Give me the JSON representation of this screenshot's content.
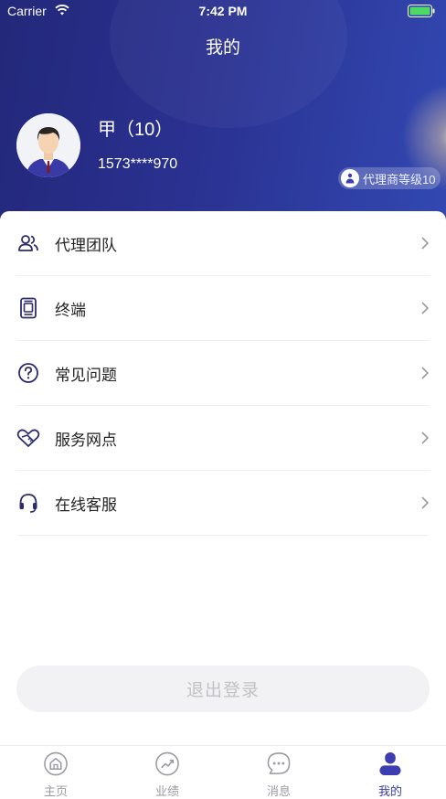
{
  "status_bar": {
    "carrier": "Carrier",
    "time": "7:42 PM"
  },
  "header": {
    "title": "我的"
  },
  "user": {
    "name": "甲（10）",
    "phone": "1573****970",
    "level": "代理商等级10"
  },
  "menu": [
    {
      "label": "代理团队",
      "icon": "team-icon"
    },
    {
      "label": "终端",
      "icon": "terminal-icon"
    },
    {
      "label": "常见问题",
      "icon": "question-icon"
    },
    {
      "label": "服务网点",
      "icon": "heart-handshake-icon"
    },
    {
      "label": "在线客服",
      "icon": "headset-icon"
    }
  ],
  "logout_label": "退出登录",
  "tabs": [
    {
      "label": "主页",
      "icon": "home-icon",
      "active": false
    },
    {
      "label": "业绩",
      "icon": "trend-icon",
      "active": false
    },
    {
      "label": "消息",
      "icon": "chat-icon",
      "active": false
    },
    {
      "label": "我的",
      "icon": "profile-icon",
      "active": true
    }
  ],
  "colors": {
    "header_start": "#23287a",
    "header_end": "#3248b2",
    "accent": "#3c3db0",
    "icon": "#2b2c6e"
  }
}
